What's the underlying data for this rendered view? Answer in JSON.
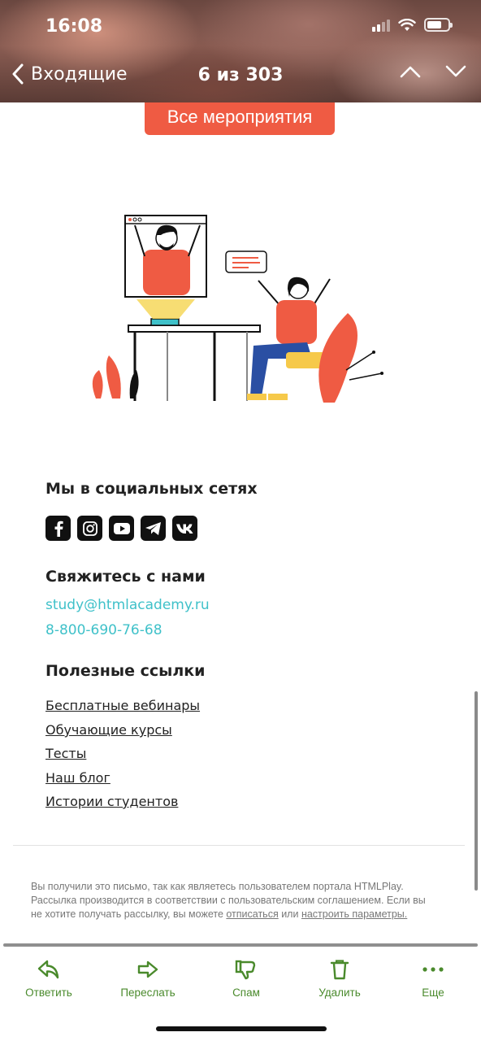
{
  "status_bar": {
    "time": "16:08"
  },
  "nav": {
    "back_label": "Входящие",
    "counter": "6 из 303"
  },
  "email": {
    "cta_label": "Все мероприятия",
    "social": {
      "title": "Мы в социальных сетях",
      "icons": [
        "facebook-icon",
        "instagram-icon",
        "youtube-icon",
        "telegram-icon",
        "vk-icon"
      ]
    },
    "contact": {
      "title": "Свяжитесь с нами",
      "email": "study@htmlacademy.ru",
      "phone": "8-800-690-76-68"
    },
    "links": {
      "title": "Полезные ссылки",
      "items": [
        "Бесплатные вебинары",
        "Обучающие курсы",
        "Тесты",
        "Наш блог",
        "Истории студентов"
      ]
    },
    "footer": {
      "text_before": "Вы получили это письмо, так как являетесь пользователем портала HTMLPlay. Рассылка производится в соответствии с пользовательским соглашением. Если вы не хотите получать рассылку, вы можете ",
      "unsubscribe": "отписаться",
      "middle": " или ",
      "settings": "настроить параметры."
    }
  },
  "toolbar": {
    "reply": "Ответить",
    "forward": "Переслать",
    "spam": "Спам",
    "delete": "Удалить",
    "more": "Еще"
  },
  "colors": {
    "accent_orange": "#ef5b43",
    "link_teal": "#3fc1c9",
    "toolbar_green": "#4a8a2c"
  }
}
